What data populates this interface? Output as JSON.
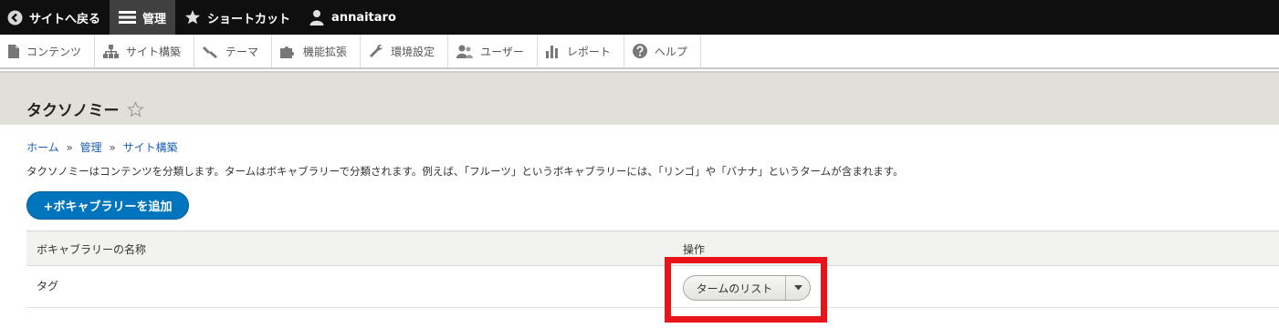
{
  "toolbar": {
    "back": "サイトへ戻る",
    "manage": "管理",
    "shortcuts": "ショートカット",
    "user": "annaitaro"
  },
  "tray": {
    "items": [
      "コンテンツ",
      "サイト構築",
      "テーマ",
      "機能拡張",
      "環境設定",
      "ユーザー",
      "レポート",
      "ヘルプ"
    ]
  },
  "page": {
    "title": "タクソノミー"
  },
  "breadcrumb": {
    "home": "ホーム",
    "separator": "»",
    "admin": "管理",
    "structure": "サイト構築"
  },
  "description": "タクソノミーはコンテンツを分類します。タームはボキャブラリーで分類されます。例えば、「フルーツ」というボキャブラリーには、「リンゴ」や「バナナ」というタームが含まれます。",
  "add_button": "+ボキャブラリーを追加",
  "table": {
    "headers": [
      "ボキャブラリーの名称",
      "操作"
    ],
    "rows": [
      {
        "name": "タグ",
        "action": "タームのリスト"
      }
    ]
  },
  "colors": {
    "primary": "#0074bd",
    "highlight": "#e8141a",
    "toolbar": "#0f0f0f"
  }
}
